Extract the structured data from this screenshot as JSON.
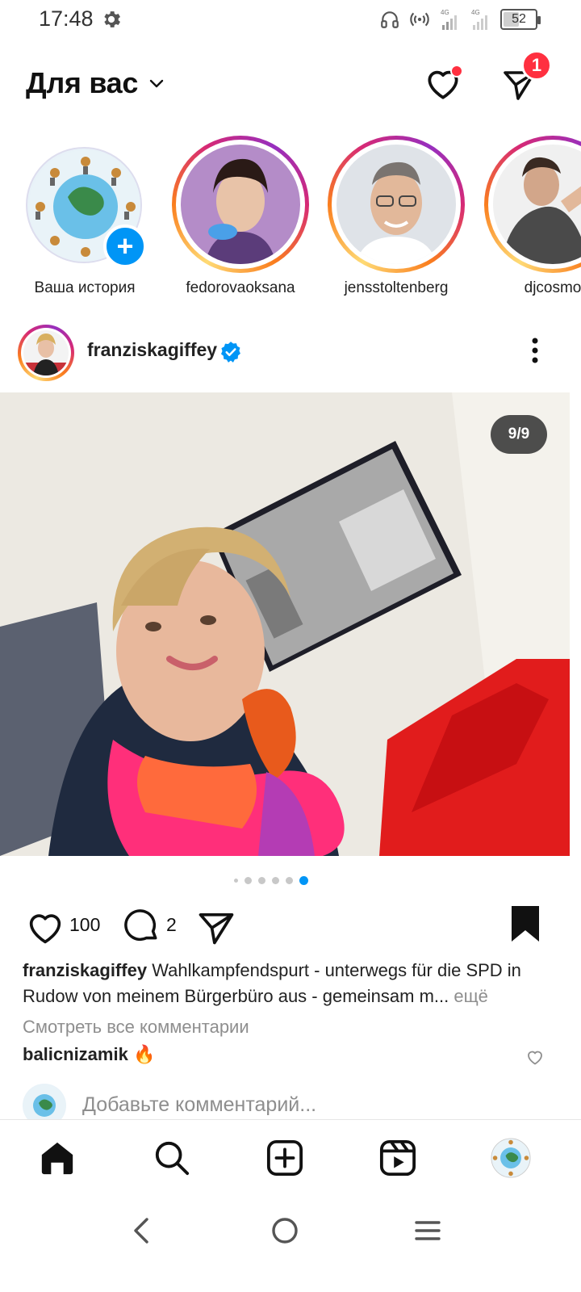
{
  "status_bar": {
    "time": "17:48",
    "battery": "52",
    "network_labels": [
      "4G",
      "4G"
    ]
  },
  "header": {
    "title": "Для вас",
    "messages_badge": "1"
  },
  "stories": [
    {
      "label": "Ваша история",
      "own": true
    },
    {
      "label": "fedorovaoksana"
    },
    {
      "label": "jensstoltenberg"
    },
    {
      "label": "djcosmo"
    }
  ],
  "post": {
    "username": "franziskagiffey",
    "verified": true,
    "carousel_counter": "9/9",
    "carousel": {
      "total_dots_visible": 6,
      "active_index": 5
    },
    "likes": "100",
    "comments": "2",
    "caption_user": "franziskagiffey",
    "caption_text": "Wahlkampfendspurt - unterwegs für die SPD in Rudow von meinem Bürgerbüro aus - gemeinsam m...",
    "caption_more": " ещё",
    "view_all_comments": "Смотреть все комментарии",
    "top_comment_user": "balicnizamik",
    "top_comment_text": " 🔥",
    "add_comment_placeholder": "Добавьте комментарий..."
  },
  "bottom_nav": [
    "home",
    "search",
    "create",
    "reels",
    "profile"
  ],
  "colors": {
    "accent_blue": "#0095f6",
    "notification_red": "#ff3040",
    "muted_text": "#8e8e8e"
  }
}
